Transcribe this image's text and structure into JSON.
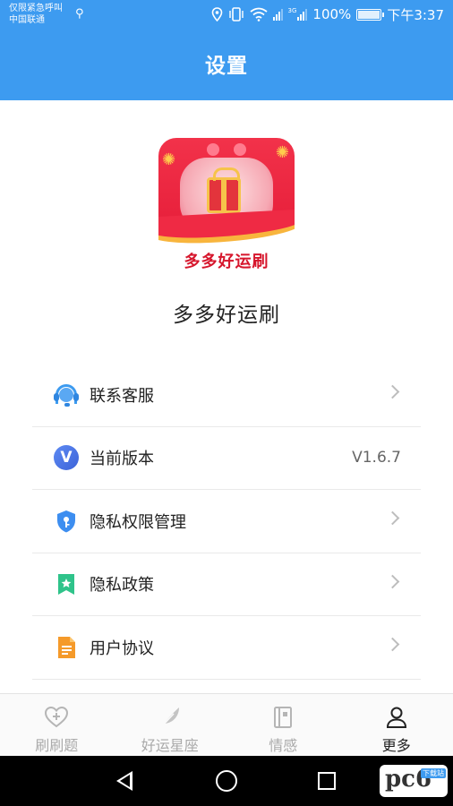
{
  "status_bar": {
    "carrier_line1": "仅限紧急呼叫",
    "carrier_line2": "中国联通",
    "network_label": "3G",
    "battery": "100%",
    "time": "下午3:37"
  },
  "header": {
    "title": "设置"
  },
  "app": {
    "logo_text": "多多好运刷",
    "name": "多多好运刷"
  },
  "menu": {
    "items": [
      {
        "label": "联系客服",
        "icon": "customer-service-icon"
      },
      {
        "label": "当前版本",
        "value": "V1.6.7",
        "icon": "version-icon"
      },
      {
        "label": "隐私权限管理",
        "icon": "shield-icon"
      },
      {
        "label": "隐私政策",
        "icon": "bookmark-icon"
      },
      {
        "label": "用户协议",
        "icon": "document-icon"
      }
    ]
  },
  "tabbar": {
    "items": [
      {
        "label": "刷刷题",
        "icon": "heart-plus-icon",
        "active": false
      },
      {
        "label": "好运星座",
        "icon": "feather-icon",
        "active": false
      },
      {
        "label": "情感",
        "icon": "book-icon",
        "active": false
      },
      {
        "label": "更多",
        "icon": "person-icon",
        "active": true
      }
    ]
  },
  "watermark": {
    "text": "pc6",
    "sub": "下载站"
  },
  "colors": {
    "header_bg": "#3d9bf0",
    "active_tab": "#222222",
    "inactive_tab": "#aaaaaa"
  }
}
